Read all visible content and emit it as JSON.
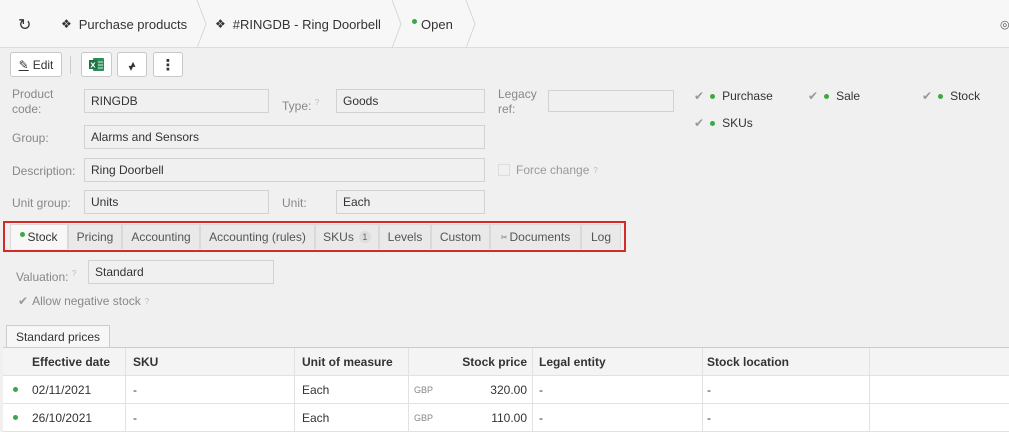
{
  "breadcrumb": {
    "items": [
      {
        "label": "Purchase products",
        "icon": "cubes-icon"
      },
      {
        "label": "#RINGDB - Ring Doorbell",
        "icon": "cubes-icon"
      },
      {
        "label": "Open",
        "icon": "status-dot"
      }
    ]
  },
  "toolbar": {
    "edit_label": "Edit",
    "excel_icon": "excel-icon",
    "sort_icon": "sort-icon",
    "more_icon": "more-vertical-icon"
  },
  "form": {
    "product_code": {
      "label": "Product code:",
      "value": "RINGDB"
    },
    "type": {
      "label": "Type:",
      "value": "Goods"
    },
    "legacy_ref": {
      "label": "Legacy ref:",
      "value": ""
    },
    "group": {
      "label": "Group:",
      "value": "Alarms and Sensors"
    },
    "description": {
      "label": "Description:",
      "value": "Ring Doorbell"
    },
    "unit_group": {
      "label": "Unit group:",
      "value": "Units"
    },
    "unit": {
      "label": "Unit:",
      "value": "Each"
    },
    "force_change": "Force change",
    "flags": {
      "purchase": "Purchase",
      "sale": "Sale",
      "stock": "Stock",
      "skus": "SKUs"
    }
  },
  "tabs": {
    "stock": "Stock",
    "pricing": "Pricing",
    "accounting": "Accounting",
    "accounting_rules": "Accounting (rules)",
    "skus": "SKUs",
    "skus_count": "1",
    "levels": "Levels",
    "custom": "Custom",
    "documents": "Documents",
    "log": "Log"
  },
  "stock": {
    "valuation_label": "Valuation:",
    "valuation_value": "Standard",
    "allow_negative": "Allow negative stock",
    "subtab": "Standard prices",
    "columns": {
      "effective_date": "Effective date",
      "sku": "SKU",
      "uom": "Unit of measure",
      "stock_price": "Stock price",
      "legal_entity": "Legal entity",
      "stock_location": "Stock location"
    },
    "rows": [
      {
        "effective_date": "02/11/2021",
        "sku": "-",
        "uom": "Each",
        "currency": "GBP",
        "stock_price": "320.00",
        "legal_entity": "-",
        "stock_location": "-"
      },
      {
        "effective_date": "26/10/2021",
        "sku": "-",
        "uom": "Each",
        "currency": "GBP",
        "stock_price": "110.00",
        "legal_entity": "-",
        "stock_location": "-"
      }
    ]
  },
  "colors": {
    "accent_green": "#3aa845",
    "tab_highlight": "#d42a2a",
    "excel_green": "#1e7145"
  }
}
